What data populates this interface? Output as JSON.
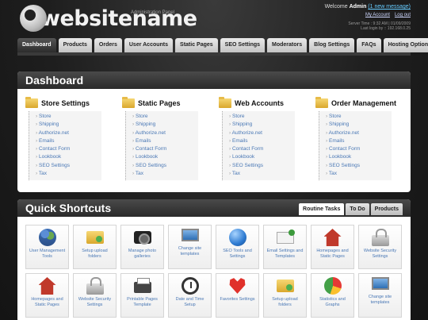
{
  "header": {
    "logo_text": "websitename",
    "admin_panel": "Administration Panel",
    "welcome_prefix": "Welcome",
    "user": "Admin",
    "messages": "(1 new message)",
    "my_account": "My Account",
    "logout": "Log out",
    "server_time": "Server Time : 9:32 AM | 01/09/2009",
    "last_login": "Last login by :: 192.168.0.25"
  },
  "nav": {
    "tabs": [
      "Dashboard",
      "Products",
      "Orders",
      "User Accounts",
      "Static Pages",
      "SEO Settings",
      "Moderators",
      "Blog Settings",
      "FAQs",
      "Hosting Options"
    ],
    "active": "Dashboard"
  },
  "dashboard": {
    "title": "Dashboard",
    "sections": [
      {
        "title": "Store Settings",
        "links": [
          "Store",
          "Shipping",
          "Authorize.net",
          "Emails",
          "Contact Form",
          "Lookbook",
          "SEO Settings",
          "Tax"
        ]
      },
      {
        "title": "Static Pages",
        "links": [
          "Store",
          "Shipping",
          "Authorize.net",
          "Emails",
          "Contact Form",
          "Lookbook",
          "SEO Settings",
          "Tax"
        ]
      },
      {
        "title": "Web Accounts",
        "links": [
          "Store",
          "Shipping",
          "Authorize.net",
          "Emails",
          "Contact Form",
          "Lookbook",
          "SEO Settings",
          "Tax"
        ]
      },
      {
        "title": "Order Management",
        "links": [
          "Store",
          "Shipping",
          "Authorize.net",
          "Emails",
          "Contact Form",
          "Lookbook",
          "SEO Settings",
          "Tax"
        ]
      }
    ]
  },
  "quick": {
    "title": "Quick Shortcuts",
    "tabs": [
      "Routine Tasks",
      "To Do",
      "Products"
    ],
    "active_tab": "Routine Tasks",
    "shortcuts": [
      {
        "label": "User Management Tools",
        "icon": "users-icon"
      },
      {
        "label": "Setup upload folders",
        "icon": "folder-icon"
      },
      {
        "label": "Manage photo galleries",
        "icon": "camera-icon"
      },
      {
        "label": "Change site templates",
        "icon": "monitor-icon"
      },
      {
        "label": "SEO Tools and Settings",
        "icon": "globe-icon"
      },
      {
        "label": "Email Settings and Templates",
        "icon": "mail-icon"
      },
      {
        "label": "Homepages and Static Pages",
        "icon": "house-icon"
      },
      {
        "label": "Website Security Settings",
        "icon": "lock-icon"
      },
      {
        "label": "Homepages and Static Pages",
        "icon": "house-icon"
      },
      {
        "label": "Website Security Settings",
        "icon": "lock-icon"
      },
      {
        "label": "Printable Pages Template",
        "icon": "printer-icon"
      },
      {
        "label": "Date and Time Setup",
        "icon": "clock-icon"
      },
      {
        "label": "Favorites Settings",
        "icon": "heart-icon"
      },
      {
        "label": "Setup upload folders",
        "icon": "folder-icon"
      },
      {
        "label": "Statistics and Graphs",
        "icon": "pie-chart-icon"
      },
      {
        "label": "Change site templates",
        "icon": "monitor-icon"
      }
    ]
  }
}
